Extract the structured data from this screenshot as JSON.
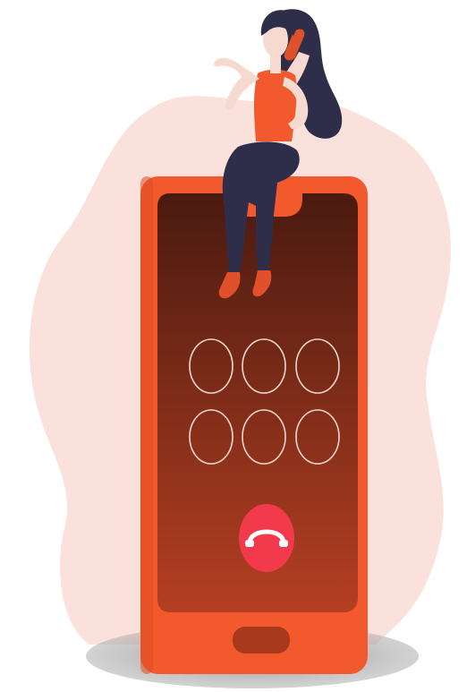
{
  "illustration": {
    "subject": "woman-sitting-on-phone-talking",
    "keypad": {
      "rows": 2,
      "cols": 3
    },
    "end_call_icon": "phone-hangup-icon",
    "home_button_icon": "home-button"
  },
  "colors": {
    "blob": "#fbe1dc",
    "phone_body": "#f25a2e",
    "phone_body_dark": "#de4a22",
    "screen_top": "#4a1a10",
    "screen_bottom": "#b53f22",
    "keypad_stroke": "#f3d6cc",
    "end_call": "#f23a4c",
    "shadow": "#9a9a9a",
    "hair": "#2f2e4a",
    "pants": "#2f2e4a",
    "top": "#f25a2e",
    "skin": "#f6d9cf",
    "shoe": "#e0502a"
  }
}
